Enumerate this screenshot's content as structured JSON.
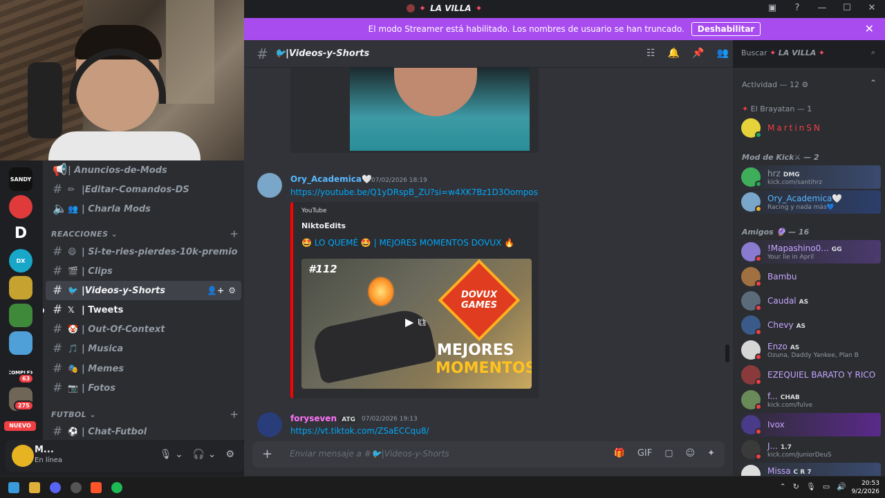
{
  "window": {
    "title": "LA VILLA",
    "title_icon": "server-avatar",
    "controls": [
      "inbox-icon",
      "help-icon",
      "minimize",
      "maximize",
      "close"
    ]
  },
  "banner": {
    "text": "El modo Streamer está habilitado. Los nombres de usuario se han truncado.",
    "button": "Deshabilitar"
  },
  "servers": [
    {
      "label": "SANDY",
      "color": "#111111"
    },
    {
      "label": "",
      "color": "#e03b3b"
    },
    {
      "label": "D",
      "color": "#1e1f22"
    },
    {
      "label": "DX",
      "color": "#19a7c9"
    },
    {
      "label": "",
      "color": "#c6a231"
    },
    {
      "label": "",
      "color": "#3f8a3a"
    },
    {
      "label": "",
      "color": "#4fa0d9"
    },
    {
      "label": "COMPLEX",
      "color": "#1e1f22",
      "badge": "63"
    },
    {
      "label": "",
      "color": "#6f6657",
      "badge": "275"
    }
  ],
  "nuevo_label": "NUEVO",
  "channels": {
    "items": [
      {
        "emoji": "📢",
        "label": "| Anuncios-de-Mods",
        "type": "text"
      },
      {
        "emoji": "✏",
        "label": "|Editar-Comandos-DS",
        "type": "text"
      },
      {
        "emoji": "👥",
        "label": "| Charla Mods",
        "type": "voice"
      }
    ],
    "category_reacciones": "REACCIONES",
    "reacciones": [
      {
        "emoji": "😄",
        "label": "| Si-te-ries-pierdes-10k-premio"
      },
      {
        "emoji": "🎬",
        "label": "| Clips"
      },
      {
        "emoji": "🐦",
        "label": "|Videos-y-Shorts",
        "active": true
      },
      {
        "emoji": "𝕏",
        "label": "| Tweets",
        "unread": true
      },
      {
        "emoji": "🤡",
        "label": "| Out-Of-Context"
      },
      {
        "emoji": "🎵",
        "label": "| Musica"
      },
      {
        "emoji": "🎭",
        "label": "| Memes"
      },
      {
        "emoji": "📷",
        "label": "| Fotos"
      }
    ],
    "category_futbol": "FUTBOL",
    "futbol": [
      {
        "emoji": "⚽",
        "label": "| Chat-Futbol"
      }
    ]
  },
  "user": {
    "name": "M...",
    "status": "En línea"
  },
  "chat": {
    "channel_name": "🐦|Videos-y-Shorts",
    "search_placeholder": "Buscar",
    "search_server": "LA VILLA",
    "composer_placeholder": "Enviar mensaje a #🐦|Videos-y-Shorts",
    "messages": [
      {
        "author": "Ory_Academica",
        "author_suffix": "🤍",
        "author_color": "#5ab8ff",
        "time": "07/02/2026 18:19",
        "link": "https://youtube.be/Q1yDRspB_ZU?si=w4XK7Bz1D3Oompos",
        "embed": {
          "provider": "YouTube",
          "author": "NiktoEdits",
          "title": "🤩 LO QUEMÉ 🤩 | MEJORES MOMENTOS DOVUX 🔥",
          "thumb_episode": "#112",
          "thumb_logo": "DOVUX GAMES",
          "thumb_line1": "MEJORES",
          "thumb_line2": "MOMENTOS"
        }
      },
      {
        "author": "foryseven",
        "author_color": "#ff73fa",
        "tag": "ATG",
        "time": "07/02/2026 19:13",
        "link": "https://vt.tiktok.com/ZSaECCqu8/"
      }
    ]
  },
  "members": {
    "activity_header": "Actividad — 12",
    "groups": [
      {
        "title": "El Brayatan — 1",
        "members": [
          {
            "name": "MartinSN",
            "color": "#f23f43",
            "avatar": "#e6d33a",
            "status": "#23a55a",
            "sub": ""
          }
        ]
      },
      {
        "title": "Mod de Kick⚔ — 2",
        "members": [
          {
            "name": "hrz",
            "tag": "DMG",
            "color": "#949ba4",
            "avatar": "#3fae5a",
            "status": "#23a55a",
            "sub": "kick.com/santihrz"
          },
          {
            "name": "Ory_Academica🤍",
            "tag": "",
            "color": "#5ab8ff",
            "avatar": "#7aa6c9",
            "status": "#f0b232",
            "sub": "Racing y nada más💙"
          }
        ]
      },
      {
        "title": "Amigos 🔮 — 16",
        "members": [
          {
            "name": "!Mapashino0...",
            "tag": "GG",
            "color": "#c6a6ff",
            "avatar": "#8a7bd1",
            "status": "#f23f43",
            "sub": "Your lie in April"
          },
          {
            "name": "Bambu",
            "tag": "",
            "color": "#c6a6ff",
            "avatar": "#a07040",
            "status": "#f23f43",
            "sub": ""
          },
          {
            "name": "Caudal",
            "tag": "AS",
            "color": "#c6a6ff",
            "avatar": "#5b6b7a",
            "status": "#f23f43",
            "sub": ""
          },
          {
            "name": "Chevy",
            "tag": "AS",
            "color": "#c6a6ff",
            "avatar": "#3a5b8a",
            "status": "#f23f43",
            "sub": ""
          },
          {
            "name": "Enzo",
            "tag": "AS",
            "color": "#c6a6ff",
            "avatar": "#d6d6d6",
            "status": "#f23f43",
            "sub": "Ozuna, Daddy Yankee, Plan B"
          },
          {
            "name": "EZEQUIEL BARATO Y RICO",
            "tag": "",
            "color": "#c6a6ff",
            "avatar": "#8a3a3a",
            "status": "#f23f43",
            "sub": ""
          },
          {
            "name": "f...",
            "tag": "CHAB",
            "color": "#c6a6ff",
            "avatar": "#6a8a5a",
            "status": "#f23f43",
            "sub": "kick.com/fulve"
          },
          {
            "name": "Ivox",
            "tag": "",
            "color": "#c6a6ff",
            "avatar": "#4a3a8a",
            "status": "#f23f43",
            "sub": ""
          },
          {
            "name": "J...",
            "tag": "1.7",
            "color": "#c6a6ff",
            "avatar": "#3a3a3a",
            "status": "#f23f43",
            "sub": "kick.com/JuniorDeuS"
          },
          {
            "name": "Missa",
            "tag": "C R 7",
            "color": "#c6a6ff",
            "avatar": "#dddddd",
            "status": "#f23f43",
            "sub": ""
          }
        ]
      }
    ]
  },
  "taskbar": {
    "time": "20:53",
    "date": "9/2/2026",
    "apps": [
      "windows-icon",
      "explorer-icon",
      "discord-icon",
      "app-icon",
      "brave-icon",
      "spotify-icon"
    ]
  }
}
